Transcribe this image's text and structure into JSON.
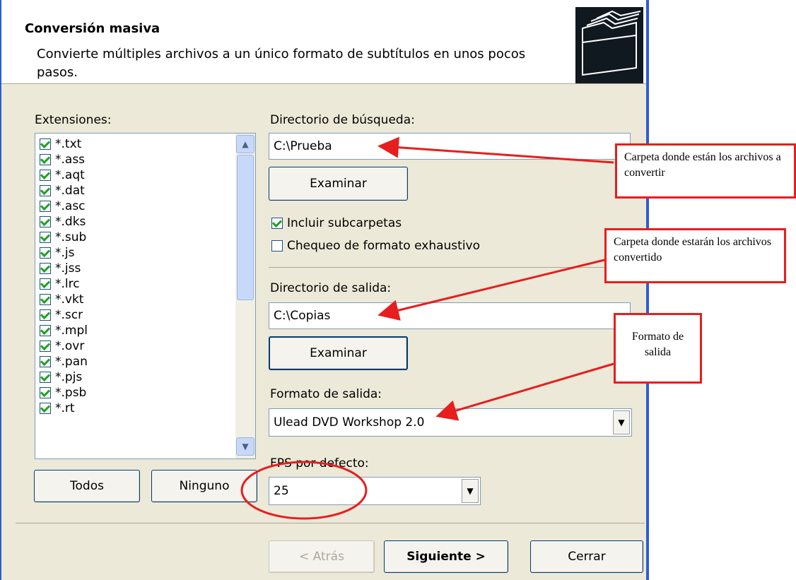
{
  "header": {
    "title": "Conversión masiva",
    "description": "Convierte múltiples archivos a un único formato de subtítulos en unos pocos pasos."
  },
  "extensions": {
    "label": "Extensiones:",
    "items": [
      "*.txt",
      "*.ass",
      "*.aqt",
      "*.dat",
      "*.asc",
      "*.dks",
      "*.sub",
      "*.js",
      "*.jss",
      "*.lrc",
      "*.vkt",
      "*.scr",
      "*.mpl",
      "*.ovr",
      "*.pan",
      "*.pjs",
      "*.psb",
      "*.rt"
    ],
    "all_button": "Todos",
    "none_button": "Ninguno"
  },
  "search": {
    "label": "Directorio de búsqueda:",
    "value": "C:\\Prueba",
    "browse_button": "Examinar",
    "include_subfolders": "Incluir subcarpetas",
    "exhaustive_check": "Chequeo de formato exhaustivo"
  },
  "output": {
    "dir_label": "Directorio de salida:",
    "dir_value": "C:\\Copias",
    "browse_button": "Examinar",
    "format_label": "Formato de salida:",
    "format_value": "Ulead DVD Workshop 2.0",
    "fps_label": "FPS por defecto:",
    "fps_value": "25"
  },
  "footer": {
    "back_button": "< Atrás",
    "next_button": "Siguiente >",
    "close_button": "Cerrar"
  },
  "annotations": {
    "search_callout": "Carpeta donde están los archivos a convertir",
    "output_callout": "Carpeta donde estarán los archivos convertido",
    "format_callout": "Formato de salida"
  },
  "colors": {
    "annotation_red": "#e61e1e",
    "window_border": "#2e5bd8",
    "dialog_bg": "#ece9d8"
  }
}
